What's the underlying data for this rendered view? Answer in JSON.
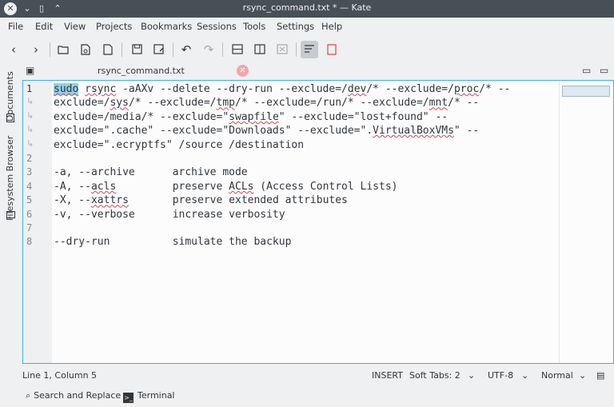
{
  "window": {
    "title": "rsync_command.txt * — Kate"
  },
  "menu": [
    "File",
    "Edit",
    "View",
    "Projects",
    "Bookmarks",
    "Sessions",
    "Tools",
    "Settings",
    "Help"
  ],
  "sidebar": {
    "documents": "Documents",
    "filesystem": "Filesystem Browser"
  },
  "tab": {
    "name": "rsync_command.txt"
  },
  "icons": {
    "back": "arrow-left-icon",
    "forward": "arrow-right-icon",
    "open": "folder-open-icon",
    "new": "new-file-icon",
    "save": "save-icon",
    "undo": "undo-icon",
    "redo": "redo-icon"
  },
  "lines": [
    "1",
    "2",
    "3",
    "4",
    "5",
    "6",
    "7",
    "8"
  ],
  "status": {
    "position": "Line 1, Column 5",
    "mode": "INSERT",
    "indent": "Soft Tabs: 2",
    "encoding": "UTF-8",
    "syntax": "Normal"
  },
  "bottom": {
    "search": "Search and Replace",
    "terminal": "Terminal"
  },
  "colors": {
    "titlebar": "#475057",
    "focus": "#3daee9",
    "selection": "#93cee9",
    "spell": "#da4453"
  }
}
